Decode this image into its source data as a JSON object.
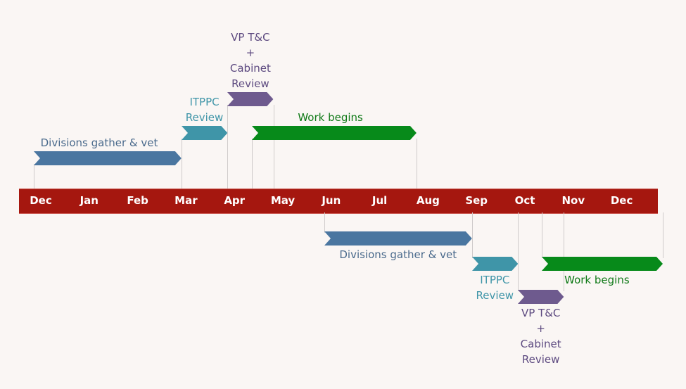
{
  "colors": {
    "background": "#faf6f4",
    "axis": "#a5170f",
    "axis_text": "#ffffff",
    "divisions": "#4a76a0",
    "itppc": "#3f95a8",
    "vp": "#6e5a8e",
    "work": "#078a1a",
    "connector": "#cfcbcb"
  },
  "chart_data": {
    "type": "gantt",
    "title": "",
    "axis_months": [
      "Dec",
      "Jan",
      "Feb",
      "Mar",
      "Apr",
      "May",
      "Jun",
      "Jul",
      "Aug",
      "Sep",
      "Oct",
      "Nov",
      "Dec"
    ],
    "tasks": [
      {
        "id": "div1",
        "label": "Divisions gather & vet",
        "lines": [
          "Divisions gather & vet"
        ],
        "start": 0.0,
        "end": 3.05,
        "color_key": "divisions",
        "side": "above",
        "level": 2
      },
      {
        "id": "itppc1",
        "label": "ITPPC Review",
        "lines": [
          "ITPPC",
          "Review"
        ],
        "start": 3.05,
        "end": 4.0,
        "color_key": "itppc",
        "side": "above",
        "level": 3
      },
      {
        "id": "vp1",
        "label": "VP T&C + Cabinet Review",
        "lines": [
          "VP T&C",
          "+",
          "Cabinet",
          "Review"
        ],
        "start": 4.0,
        "end": 4.95,
        "color_key": "vp",
        "side": "above",
        "level": 4
      },
      {
        "id": "work1",
        "label": "Work begins",
        "lines": [
          "Work begins"
        ],
        "start": 4.5,
        "end": 7.9,
        "color_key": "work",
        "side": "above",
        "level": 3
      },
      {
        "id": "div2",
        "label": "Divisions gather & vet",
        "lines": [
          "Divisions gather & vet"
        ],
        "start": 6.0,
        "end": 9.05,
        "color_key": "divisions",
        "side": "below",
        "level": 1
      },
      {
        "id": "itppc2",
        "label": "ITPPC Review",
        "lines": [
          "ITPPC",
          "Review"
        ],
        "start": 9.05,
        "end": 10.0,
        "color_key": "itppc",
        "side": "below",
        "level": 2
      },
      {
        "id": "vp2",
        "label": "VP T&C + Cabinet Review",
        "lines": [
          "VP T&C",
          "+",
          "Cabinet",
          "Review"
        ],
        "start": 10.0,
        "end": 10.95,
        "color_key": "vp",
        "side": "below",
        "level": 3
      },
      {
        "id": "work2",
        "label": "Work begins",
        "lines": [
          "Work begins"
        ],
        "start": 10.5,
        "end": 13.0,
        "color_key": "work",
        "side": "below",
        "level": 2
      }
    ]
  }
}
